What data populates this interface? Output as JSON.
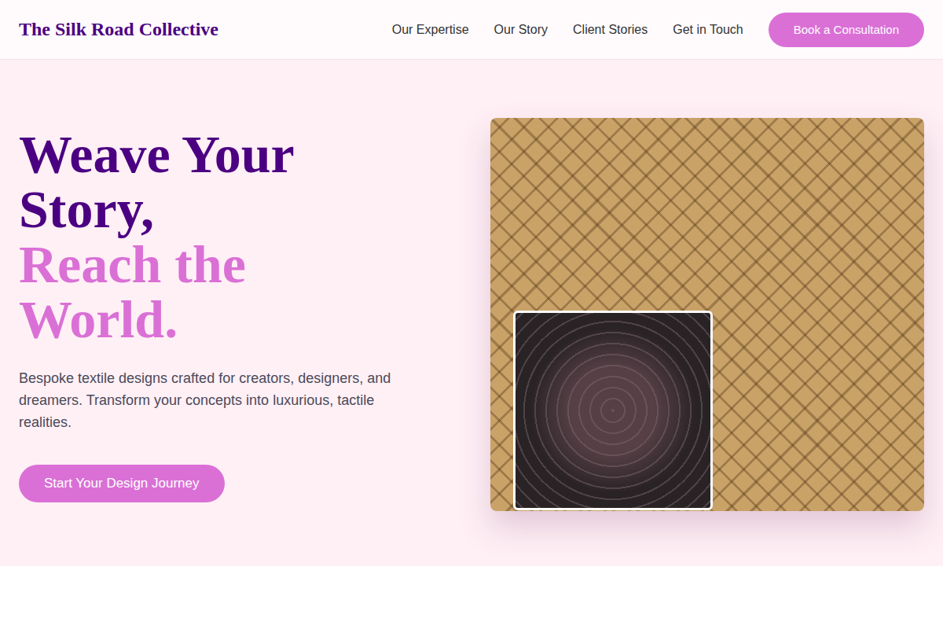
{
  "nav": {
    "brand": "The Silk Road Collective",
    "links": [
      "Our Expertise",
      "Our Story",
      "Client Stories",
      "Get in Touch"
    ],
    "cta": "Book a Consultation"
  },
  "hero": {
    "headline": "Weave Your Story,",
    "highlight": "Reach the World.",
    "description": "Bespoke textile designs crafted for creators, designers, and dreamers. Transform your concepts into luxurious, tactile realities.",
    "button": "Start Your Design Journey"
  }
}
